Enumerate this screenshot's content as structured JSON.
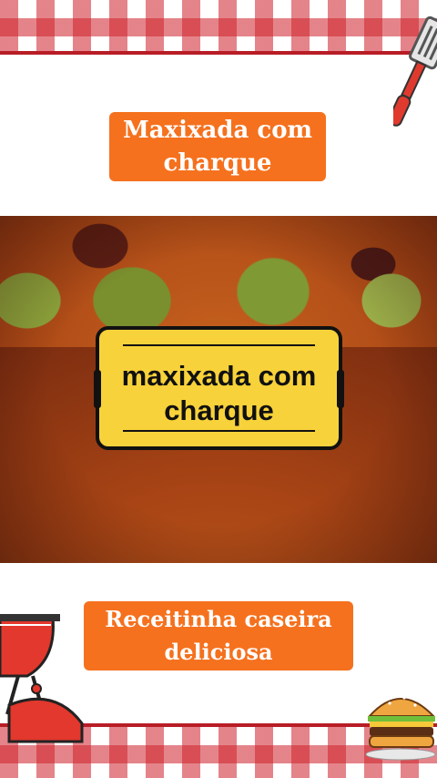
{
  "top_label": {
    "line1": "Maxixada com",
    "line2": "charque"
  },
  "card": {
    "line1": "maxixada com",
    "line2": "charque"
  },
  "bottom_label": {
    "line1": "Receitinha caseira",
    "line2": "deliciosa"
  },
  "colors": {
    "pill_bg": "#f5711e",
    "card_bg": "#f8d23a",
    "checker_red": "#ce2029"
  },
  "icons": [
    "spatula-icon",
    "grill-icon",
    "burger-icon"
  ]
}
